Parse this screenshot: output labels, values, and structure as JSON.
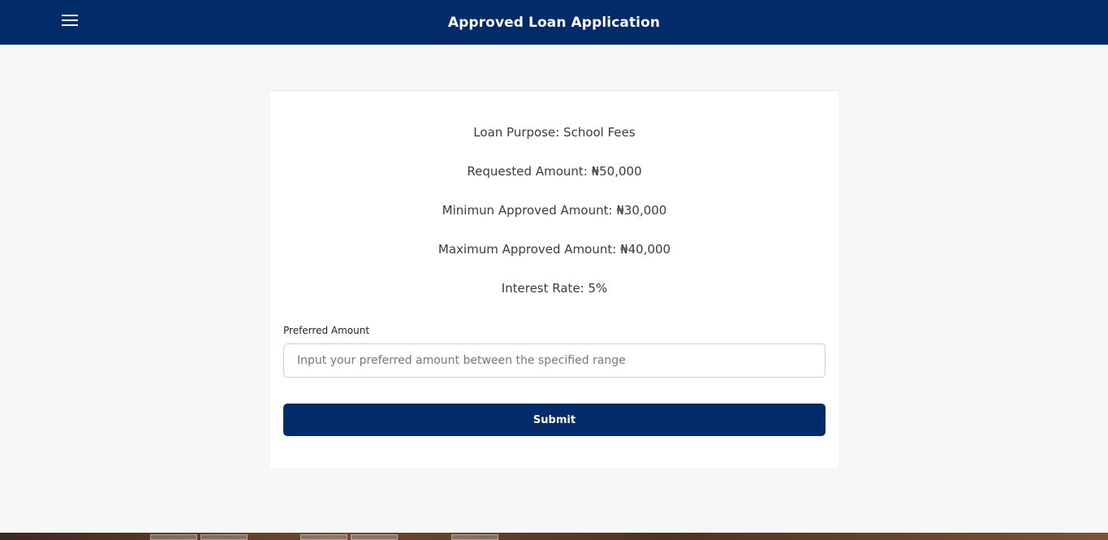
{
  "header": {
    "title": "Approved Loan Application",
    "menu_icon": "hamburger-menu-icon"
  },
  "loan": {
    "purpose": "Loan Purpose: School Fees",
    "requested": "Requested Amount: ₦50,000",
    "min_approved": "Minimun Approved Amount: ₦30,000",
    "max_approved": "Maximum Approved Amount: ₦40,000",
    "interest": "Interest Rate: 5%"
  },
  "form": {
    "preferred_label": "Preferred Amount",
    "preferred_value": "",
    "preferred_placeholder": "Input your preferred amount between the specified range",
    "submit_label": "Submit"
  },
  "colors": {
    "primary": "#022b69",
    "background": "#f7f7f7",
    "card": "#ffffff"
  }
}
